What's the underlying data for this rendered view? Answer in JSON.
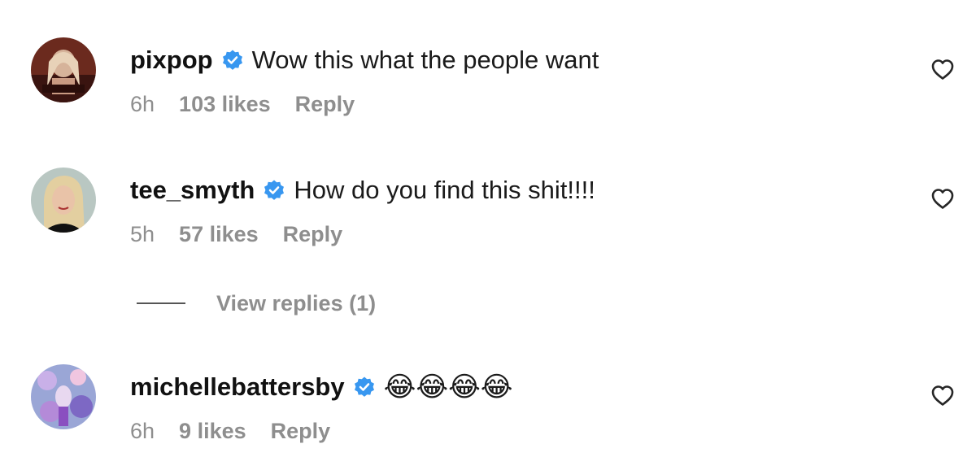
{
  "comments": [
    {
      "username": "pixpop",
      "text": "Wow this what the people want",
      "time": "6h",
      "likes": "103 likes",
      "reply": "Reply",
      "avatar_icon": "avatar-pixpop"
    },
    {
      "username": "tee_smyth",
      "text": "How do you find this shit!!!!",
      "time": "5h",
      "likes": "57 likes",
      "reply": "Reply",
      "avatar_icon": "avatar-tee-smyth"
    },
    {
      "username": "michellebattersby",
      "text": "😂😂😂😂",
      "time": "6h",
      "likes": "9 likes",
      "reply": "Reply",
      "avatar_icon": "avatar-michellebattersby"
    }
  ],
  "view_replies": {
    "label": "View replies (1)"
  },
  "colors": {
    "verified_blue": "#3897f0",
    "meta_gray": "#8e8e8e",
    "text_dark": "#1a1a1a"
  },
  "icons": {
    "verified": "verified-badge-icon",
    "like": "heart-outline-icon",
    "emoji": "face-with-tears-of-joy-icon"
  }
}
